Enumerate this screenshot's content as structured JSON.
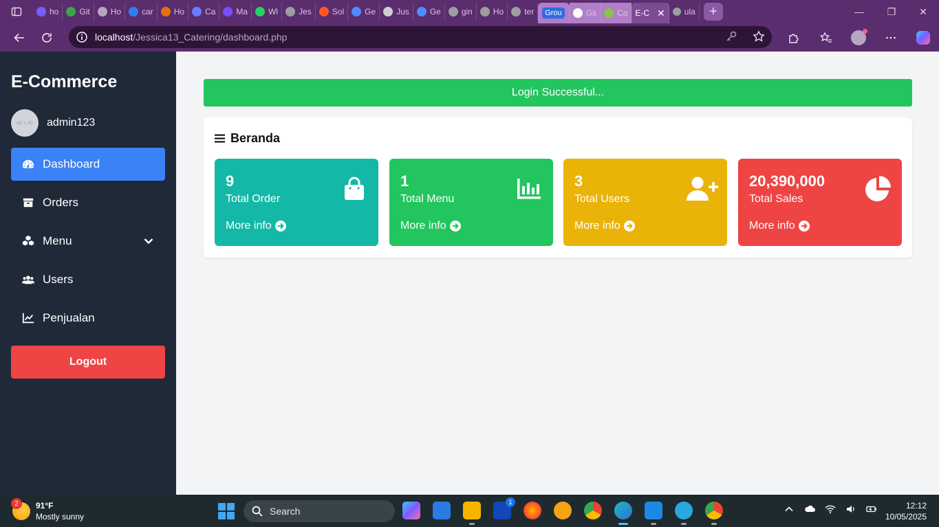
{
  "browser": {
    "tabs": [
      {
        "label": "ho",
        "color": "#7b5cff"
      },
      {
        "label": "Git",
        "color": "#3fa34d"
      },
      {
        "label": "Ho",
        "color": "#b7a6bf"
      },
      {
        "label": "car",
        "color": "#2f80ed"
      },
      {
        "label": "Ho",
        "color": "#e8710a"
      },
      {
        "label": "Ca",
        "color": "#6b7cff"
      },
      {
        "label": "Ma",
        "color": "#7c4dff"
      },
      {
        "label": "Wl",
        "color": "#25d366"
      },
      {
        "label": "Jes",
        "color": "#9e9e9e"
      },
      {
        "label": "Sol",
        "color": "#ff5722"
      },
      {
        "label": "Ge",
        "color": "#4f8cff"
      },
      {
        "label": "Jus",
        "color": "#cfcfcf"
      },
      {
        "label": "Ge",
        "color": "#4f8cff"
      },
      {
        "label": "gin",
        "color": "#9e9e9e"
      },
      {
        "label": "Ho",
        "color": "#9e9e9e"
      },
      {
        "label": "ter",
        "color": "#9e9e9e"
      }
    ],
    "group_label": "Grou",
    "group_tabs": [
      {
        "label": "Git",
        "color": "#ffffff"
      },
      {
        "label": "Ca",
        "color": "#8bc34a"
      }
    ],
    "active_tab": {
      "label": "E-C",
      "close": "✕"
    },
    "last_tab": {
      "label": "ula"
    },
    "new_tab": "+",
    "window_controls": {
      "minimize": "—",
      "restore": "❐",
      "close": "✕"
    },
    "url_host": "localhost",
    "url_path": "/Jessica13_Catering/dashboard.php"
  },
  "sidebar": {
    "brand": "E-Commerce",
    "avatar_placeholder": "40 × 40",
    "username": "admin123",
    "items": [
      {
        "label": "Dashboard",
        "icon": "gauge-icon"
      },
      {
        "label": "Orders",
        "icon": "box-icon"
      },
      {
        "label": "Menu",
        "icon": "cubes-icon"
      },
      {
        "label": "Users",
        "icon": "users-icon"
      },
      {
        "label": "Penjualan",
        "icon": "chart-line-icon"
      }
    ],
    "logout": "Logout"
  },
  "alert": {
    "message": "Login Successful..."
  },
  "panel": {
    "title": "Beranda",
    "cards": [
      {
        "value": "9",
        "label": "Total Order",
        "more": "More info",
        "color": "#14b8a6",
        "icon": "shopping-bag-icon"
      },
      {
        "value": "1",
        "label": "Total Menu",
        "more": "More info",
        "color": "#22c55e",
        "icon": "bar-chart-icon"
      },
      {
        "value": "3",
        "label": "Total Users",
        "more": "More info",
        "color": "#eab308",
        "icon": "user-plus-icon"
      },
      {
        "value": "20,390,000",
        "label": "Total Sales",
        "more": "More info",
        "color": "#ef4444",
        "icon": "pie-chart-icon"
      }
    ]
  },
  "taskbar": {
    "weather_badge": "2",
    "temperature": "91°F",
    "condition": "Mostly sunny",
    "search": "Search",
    "outlook_badge": "1",
    "time": "12:12",
    "date": "10/05/2025"
  }
}
